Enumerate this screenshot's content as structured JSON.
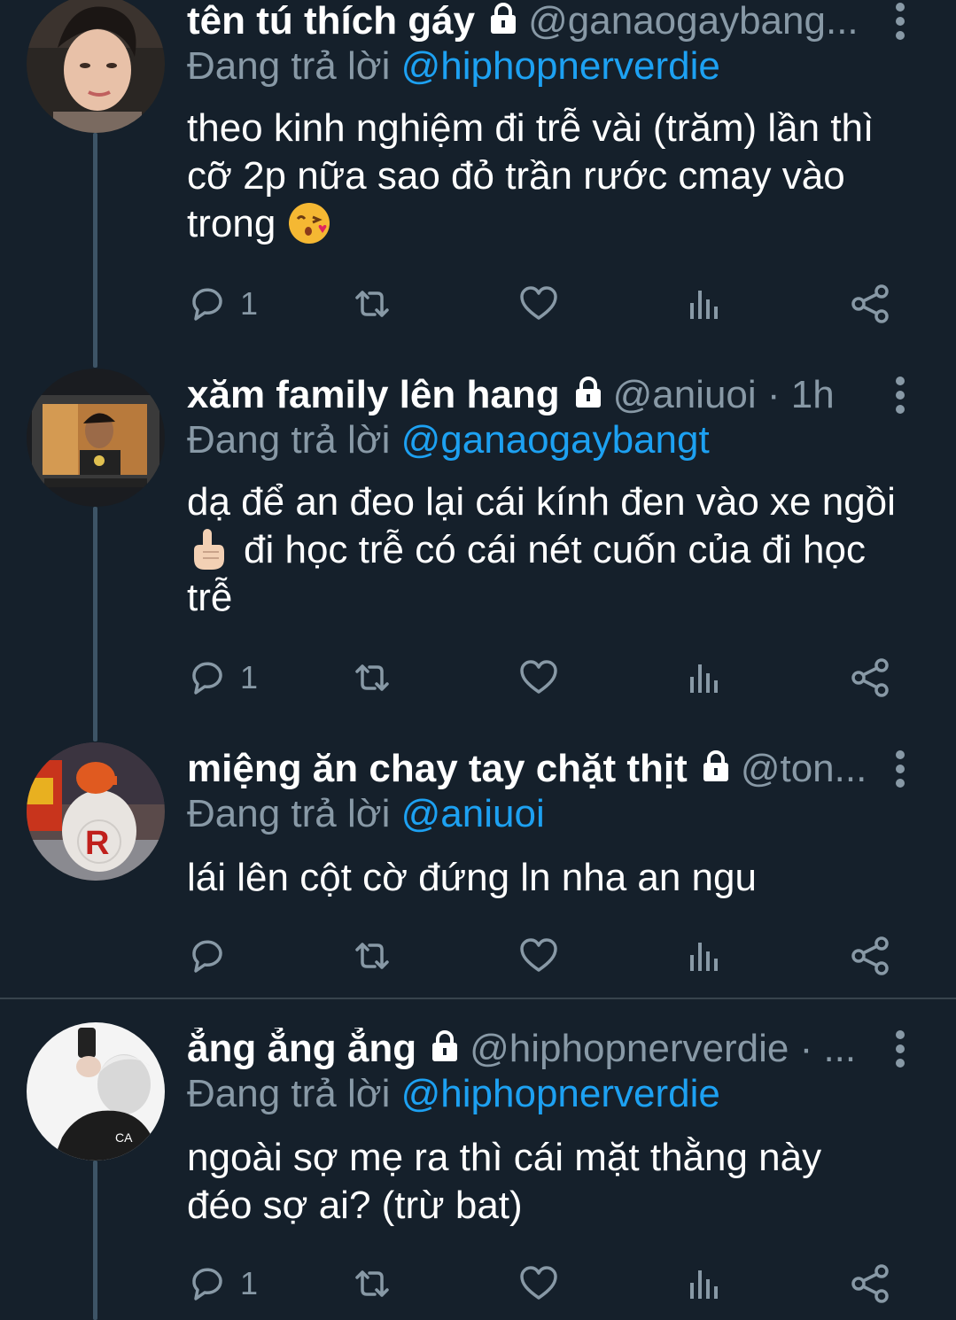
{
  "colors": {
    "background": "#15202b",
    "text_primary": "#ffffff",
    "text_secondary": "#8899a6",
    "mention": "#1da1f2",
    "thread_line": "#3d5466"
  },
  "tweets": [
    {
      "name": "tên tú thích gáy",
      "handle_meta": "@ganaogaybang...",
      "replying_prefix": "Đang trả lời",
      "replying_to": "@hiphopnerverdie",
      "body_lines": [
        "theo kinh nghiệm đi trễ vài (trăm) lần thì",
        "cỡ 2p nữa sao đỏ trần rước cmay vào",
        "trong"
      ],
      "body_emoji": "kissing-face-heart-emoji",
      "reply_count": "1"
    },
    {
      "name": "xăm family lên hang",
      "handle_meta": "@aniuoi · 1h",
      "replying_prefix": "Đang trả lời",
      "replying_to": "@ganaogaybangt",
      "body_lines": [
        "dạ để an đeo lại cái kính đen vào xe ngồi",
        "đi học trễ có cái nét cuốn của đi học",
        "trễ"
      ],
      "body_emoji": "hand-pointing-emoji",
      "reply_count": "1"
    },
    {
      "name": "miệng ăn chay tay chặt thịt",
      "handle_meta": "@ton...",
      "replying_prefix": "Đang trả lời",
      "replying_to": "@aniuoi",
      "body_lines": [
        "lái lên cột cờ đứng ln nha an ngu"
      ],
      "reply_count": ""
    },
    {
      "name": "ẳng ẳng ẳng",
      "handle_meta": "@hiphopnerverdie · ...",
      "replying_prefix": "Đang trả lời",
      "replying_to": "@hiphopnerverdie",
      "body_lines": [
        "ngoài sợ mẹ ra thì cái mặt thằng này",
        "đéo sợ ai? (trừ bat)"
      ],
      "reply_count": "1"
    }
  ]
}
